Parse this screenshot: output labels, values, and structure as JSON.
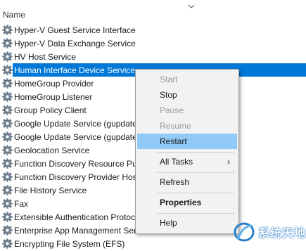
{
  "column_header": "Name",
  "services": [
    {
      "name": "Hyper-V Guest Service Interface",
      "selected": false
    },
    {
      "name": "Hyper-V Data Exchange Service",
      "selected": false
    },
    {
      "name": "HV Host Service",
      "selected": false
    },
    {
      "name": "Human Interface Device Service",
      "selected": true
    },
    {
      "name": "HomeGroup Provider",
      "selected": false
    },
    {
      "name": "HomeGroup Listener",
      "selected": false
    },
    {
      "name": "Group Policy Client",
      "selected": false
    },
    {
      "name": "Google Update Service (gupdate",
      "selected": false
    },
    {
      "name": "Google Update Service (gupdate",
      "selected": false
    },
    {
      "name": "Geolocation Service",
      "selected": false
    },
    {
      "name": "Function Discovery Resource Pul",
      "selected": false
    },
    {
      "name": "Function Discovery Provider Hos",
      "selected": false
    },
    {
      "name": "File History Service",
      "selected": false
    },
    {
      "name": "Fax",
      "selected": false
    },
    {
      "name": "Extensible Authentication Protoc",
      "selected": false
    },
    {
      "name": "Enterprise App Management Serv",
      "selected": false
    },
    {
      "name": "Encrypting File System (EFS)",
      "selected": false
    }
  ],
  "context_menu": {
    "items": [
      {
        "label": "Start",
        "state": "disabled"
      },
      {
        "label": "Stop",
        "state": "normal"
      },
      {
        "label": "Pause",
        "state": "disabled"
      },
      {
        "label": "Resume",
        "state": "disabled"
      },
      {
        "label": "Restart",
        "state": "highlighted"
      },
      {
        "label": "All Tasks",
        "state": "submenu"
      },
      {
        "label": "Refresh",
        "state": "normal"
      },
      {
        "label": "Properties",
        "state": "bold"
      },
      {
        "label": "Help",
        "state": "normal"
      }
    ],
    "submenu_arrow": "›"
  },
  "watermark": {
    "text": "系统天地",
    "color": "#2a7fc8"
  },
  "colors": {
    "selection": "#0078d7",
    "menu_highlight": "#91c9f7",
    "menu_bg": "#f2f2f2"
  }
}
